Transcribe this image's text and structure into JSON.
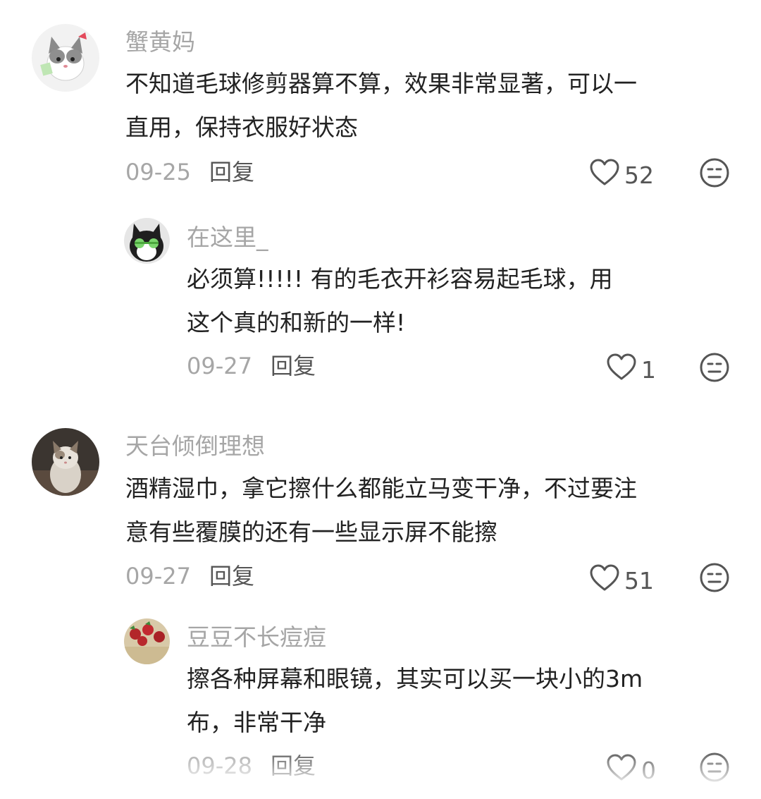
{
  "comments": [
    {
      "username": "蟹黄妈",
      "text_lines": [
        "不知道毛球修剪器算不算，效果非常显著，可以一",
        "直用，保持衣服好状态"
      ],
      "date": "09-25",
      "reply_label": "回复",
      "likes": "52"
    },
    {
      "username": "在这里_",
      "text_lines": [
        "必须算!!!!!  有的毛衣开衫容易起毛球，用",
        "这个真的和新的一样!"
      ],
      "date": "09-27",
      "reply_label": "回复",
      "likes": "1"
    },
    {
      "username": "天台倾倒理想",
      "text_lines": [
        "酒精湿巾，拿它擦什么都能立马变干净，不过要注",
        "意有些覆膜的还有一些显示屏不能擦"
      ],
      "date": "09-27",
      "reply_label": "回复",
      "likes": "51"
    },
    {
      "username": "豆豆不长痘痘",
      "text_lines": [
        "擦各种屏幕和眼镜，其实可以买一块小的3m",
        "布，非常干净"
      ],
      "date": "09-28",
      "reply_label": "回复",
      "likes": "0"
    }
  ],
  "icons": {
    "like": "heart-outline-icon",
    "react": "neutral-face-icon"
  },
  "colors": {
    "username": "#a6a6a6",
    "text": "#222222",
    "date": "#a6a6a6",
    "icon": "#555555"
  }
}
